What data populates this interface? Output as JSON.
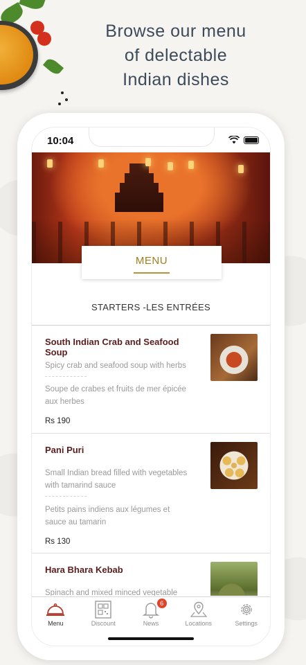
{
  "promo": {
    "headline_line1": "Browse our menu",
    "headline_line2": "of delectable",
    "headline_line3": "Indian dishes"
  },
  "status_bar": {
    "time": "10:04"
  },
  "menu": {
    "title": "MENU",
    "section_title": "STARTERS -LES ENTRÉES",
    "items": [
      {
        "name": "South Indian Crab and Seafood Soup",
        "description_en": "Spicy crab and seafood soup with herbs",
        "description_fr": "Soupe de crabes et fruits de mer épicée aux herbes",
        "price": "Rs 190",
        "image": "crab-seafood-soup-photo"
      },
      {
        "name": "Pani Puri",
        "description_en": "Small Indian bread filled with vegetables with tamarind sauce",
        "description_fr": "Petits pains indiens aux légumes et sauce au tamarin",
        "price": "Rs 130",
        "image": "pani-puri-photo"
      },
      {
        "name": "Hara Bhara Kebab",
        "description_en": "Spinach and mixed minced vegetable patties",
        "image": "hara-bhara-kebab-photo"
      }
    ]
  },
  "tabbar": {
    "tabs": [
      {
        "label": "Menu",
        "icon": "cloche-icon",
        "active": true
      },
      {
        "label": "Discount",
        "icon": "qr-code-icon"
      },
      {
        "label": "News",
        "icon": "bell-icon",
        "badge": "6"
      },
      {
        "label": "Locations",
        "icon": "map-pin-icon"
      },
      {
        "label": "Settings",
        "icon": "gear-icon"
      }
    ]
  },
  "colors": {
    "accent_gold": "#a07d1c",
    "dish_name": "#5a1c1c",
    "badge": "#e0442a",
    "headline": "#3d4a5a"
  }
}
